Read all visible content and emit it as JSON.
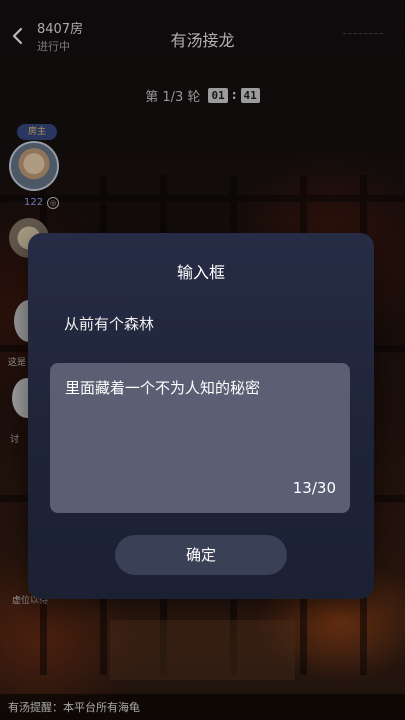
{
  "header": {
    "room_number": "8407房",
    "room_status": "进行中",
    "title": "有汤接龙"
  },
  "round": {
    "label": "第 1/3 轮",
    "minutes": "01",
    "seconds": "41"
  },
  "players": {
    "owner_badge": "房主",
    "owner_score": "122"
  },
  "side_labels": {
    "label_1": "这是",
    "label_2": "讨",
    "label_3": "虚位以待"
  },
  "notice": {
    "text": "有汤提醒：本平台所有海龟"
  },
  "modal": {
    "title": "输入框",
    "previous_sentence": "从前有个森林",
    "input_value": "里面藏着一个不为人知的秘密",
    "counter": "13/30",
    "confirm_label": "确定"
  },
  "colors": {
    "modal_bg": "#262c45",
    "input_bg": "#5b5f74",
    "button_bg": "#3a4056",
    "owner_badge_bg": "#3a4d86"
  }
}
